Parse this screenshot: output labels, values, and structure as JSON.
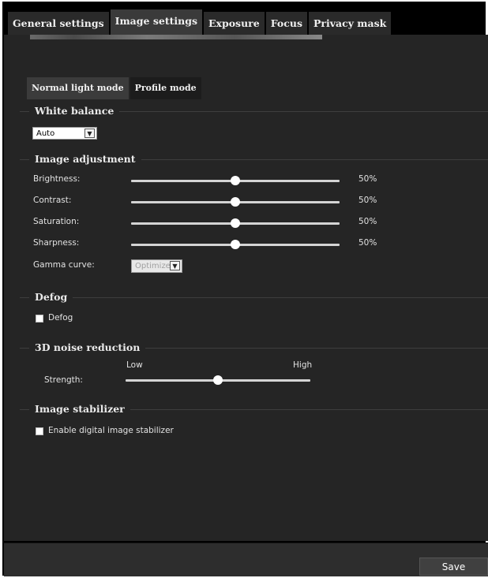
{
  "tabs": [
    {
      "label": "General settings",
      "active": false
    },
    {
      "label": "Image settings",
      "active": true
    },
    {
      "label": "Exposure",
      "active": false
    },
    {
      "label": "Focus",
      "active": false
    },
    {
      "label": "Privacy mask",
      "active": false
    }
  ],
  "mode_tabs": [
    {
      "label": "Normal light mode",
      "active": true
    },
    {
      "label": "Profile mode",
      "active": false
    }
  ],
  "white_balance": {
    "title": "White balance",
    "value": "Auto"
  },
  "image_adjustment": {
    "title": "Image adjustment",
    "sliders": [
      {
        "label": "Brightness:",
        "value": 50,
        "display": "50%"
      },
      {
        "label": "Contrast:",
        "value": 50,
        "display": "50%"
      },
      {
        "label": "Saturation:",
        "value": 50,
        "display": "50%"
      },
      {
        "label": "Sharpness:",
        "value": 50,
        "display": "50%"
      }
    ],
    "gamma": {
      "label": "Gamma curve:",
      "value": "Optimize",
      "disabled": true
    }
  },
  "defog": {
    "title": "Defog",
    "checkbox_label": "Defog",
    "checked": false
  },
  "noise_reduction": {
    "title": "3D noise reduction",
    "low_label": "Low",
    "high_label": "High",
    "strength_label": "Strength:",
    "value": 0.5
  },
  "image_stabilizer": {
    "title": "Image stabilizer",
    "checkbox_label": "Enable digital image stabilizer",
    "checked": false
  },
  "footer": {
    "save_label": "Save"
  }
}
